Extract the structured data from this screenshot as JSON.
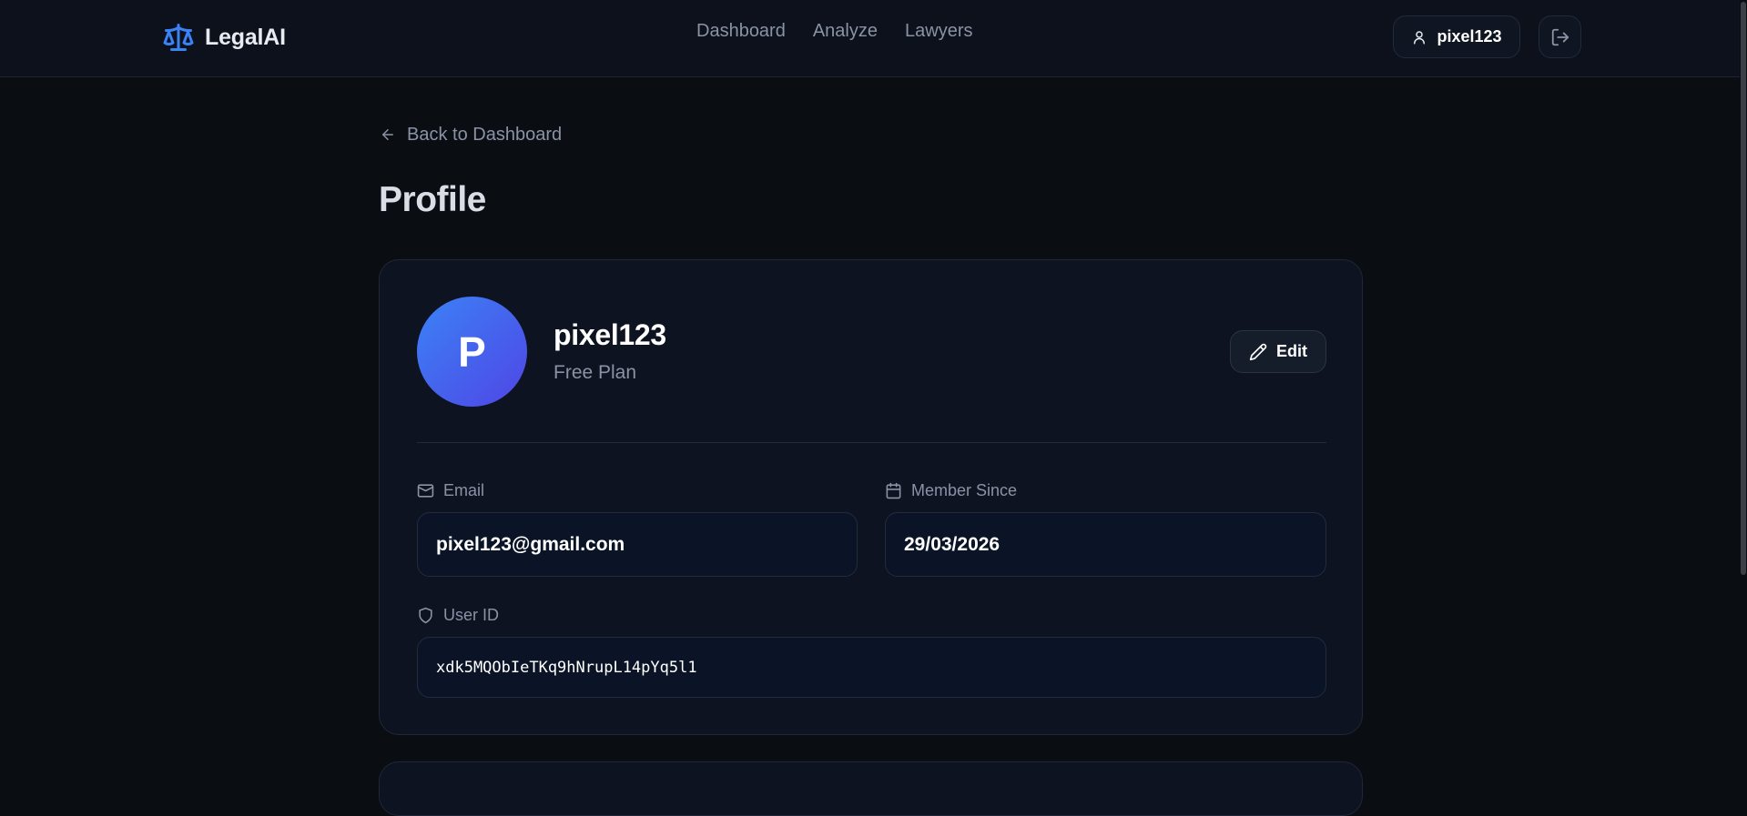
{
  "header": {
    "brand": "LegalAI",
    "brand_icon": "scale-icon",
    "nav": [
      "Dashboard",
      "Analyze",
      "Lawyers"
    ],
    "user": "pixel123",
    "logout_icon": "logout-icon"
  },
  "main": {
    "back_label": "Back to Dashboard",
    "title": "Profile"
  },
  "profile": {
    "initial": "P",
    "name": "pixel123",
    "plan": "Free Plan",
    "edit_label": "Edit",
    "fields": {
      "email": {
        "label": "Email",
        "value": "pixel123@gmail.com"
      },
      "member_since": {
        "label": "Member Since",
        "value": "29/03/2026"
      },
      "user_id": {
        "label": "User ID",
        "value": "xdk5MQObIeTKq9hNrupL14pYq5l1"
      }
    }
  },
  "colors": {
    "accent": "#3b82f6",
    "avatar_gradient_end": "#4f46e5",
    "background": "#0a0d12",
    "card": "#0d1320"
  }
}
